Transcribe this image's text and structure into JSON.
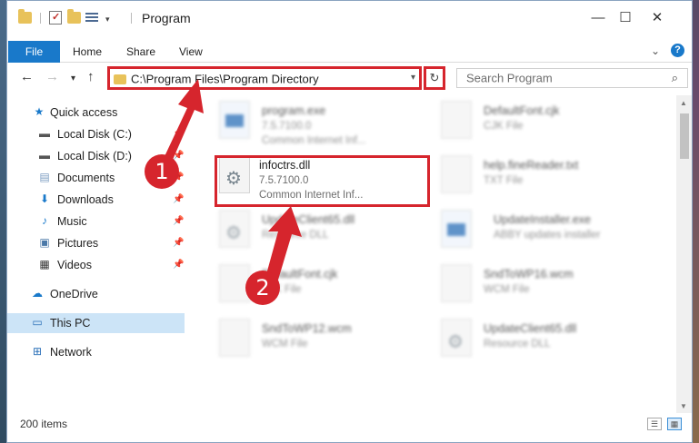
{
  "window": {
    "title": "Program"
  },
  "ribbon": {
    "file": "File",
    "home": "Home",
    "share": "Share",
    "view": "View"
  },
  "address": {
    "path": "C:\\Program Files\\Program Directory"
  },
  "search": {
    "placeholder": "Search Program"
  },
  "sidebar": {
    "items": [
      {
        "label": "Quick access",
        "icon": "star-icon",
        "pinned": false
      },
      {
        "label": "Local Disk (C:)",
        "icon": "drive-icon",
        "pinned": true
      },
      {
        "label": "Local Disk (D:)",
        "icon": "drive-icon",
        "pinned": true
      },
      {
        "label": "Documents",
        "icon": "documents-icon",
        "pinned": true
      },
      {
        "label": "Downloads",
        "icon": "download-icon",
        "pinned": true
      },
      {
        "label": "Music",
        "icon": "music-icon",
        "pinned": true
      },
      {
        "label": "Pictures",
        "icon": "pictures-icon",
        "pinned": true
      },
      {
        "label": "Videos",
        "icon": "video-icon",
        "pinned": true
      },
      {
        "label": "OneDrive",
        "icon": "cloud-icon",
        "pinned": false
      },
      {
        "label": "This PC",
        "icon": "computer-icon",
        "pinned": false,
        "selected": true
      },
      {
        "label": "Network",
        "icon": "network-icon",
        "pinned": false
      }
    ]
  },
  "files": [
    {
      "name": "program.exe",
      "version": "7.5.7100.0",
      "type": "Common Internet Inf...",
      "blurred": true
    },
    {
      "name": "DefaultFont.cjk",
      "type": "CJK File",
      "blurred": true
    },
    {
      "name": "infoctrs.dll",
      "version": "7.5.7100.0",
      "type": "Common Internet Inf...",
      "blurred": false,
      "highlighted": true
    },
    {
      "name": "help.fineReader.txt",
      "type": "TXT File",
      "blurred": true
    },
    {
      "name": "UpdateClient65.dll",
      "type": "Resource DLL",
      "blurred": true
    },
    {
      "name": "UpdateInstaller.exe",
      "type": "ABBY updates installer",
      "blurred": true
    },
    {
      "name": "DefaultFont.cjk",
      "type": "CJK File",
      "blurred": true
    },
    {
      "name": "SndToWP16.wcm",
      "type": "WCM File",
      "blurred": true
    },
    {
      "name": "SndToWP12.wcm",
      "type": "WCM File",
      "blurred": true
    },
    {
      "name": "UpdateClient65.dll",
      "type": "Resource DLL",
      "blurred": true
    }
  ],
  "status": {
    "items": "200 items"
  },
  "callouts": {
    "one": "1",
    "two": "2"
  },
  "colors": {
    "accent": "#1979ca",
    "highlight": "#d6252d",
    "selected": "#cce4f7"
  }
}
